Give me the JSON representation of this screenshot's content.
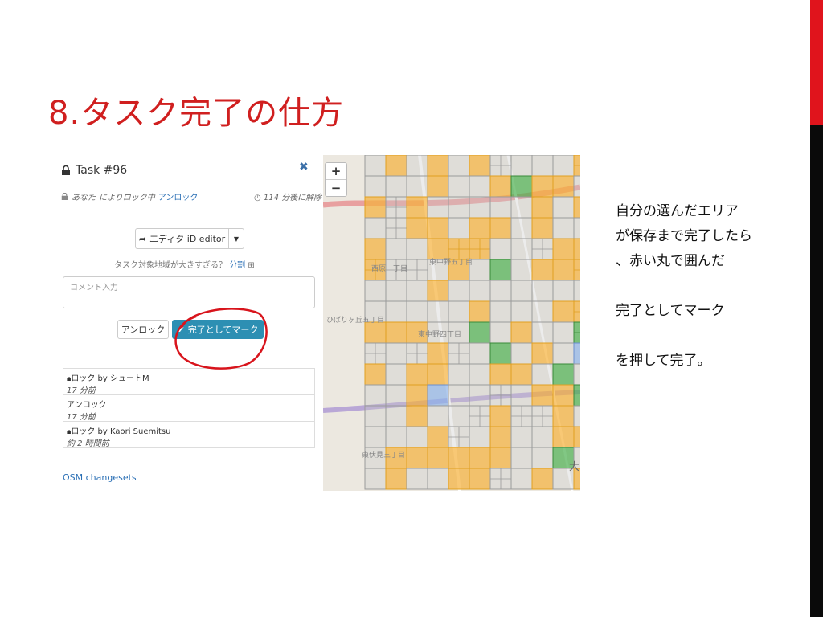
{
  "slide": {
    "title": "8.タスク完了の仕方",
    "description": "自分の選んだエリア\nが保存まで完了したら\n、赤い丸で囲んだ\n\n完了としてマーク\n\nを押して完了。"
  },
  "task": {
    "title": "Task #96",
    "locked_by_prefix": "あなた",
    "locked_status": "によりロック中",
    "unlock_link": "アンロック",
    "time_left": "114 分後に解除",
    "editor_button": "エディタ iD editor",
    "too_big_text": "タスク対象地域が大きすぎる？",
    "split_link": "分割",
    "comment_placeholder": "コメント入力",
    "unlock_button": "アンロック",
    "done_button": "完了としてマーク",
    "history": [
      {
        "action": "ロック by シュートM",
        "time": "17 分前"
      },
      {
        "action": "アンロック",
        "time": "17 分前"
      },
      {
        "action": "ロック by Kaori Suemitsu",
        "time": "約 2 時間前"
      }
    ],
    "osm_link": "OSM changesets"
  },
  "map": {
    "zoom_in": "+",
    "zoom_out": "−",
    "label_1": "東中野五丁目",
    "label_2": "東中野四丁目",
    "label_3": "東伏見三丁目",
    "label_4": "ひばりヶ丘五丁目",
    "label_5": "大",
    "label_6": "西原一丁目"
  },
  "colors": {
    "accent_red": "#e0141c",
    "title_red": "#d01f1f",
    "done_button": "#2d8fb3",
    "tile_orange": "#f5b13a",
    "tile_green": "#4caf50",
    "tile_blue": "#8fb3e8"
  }
}
